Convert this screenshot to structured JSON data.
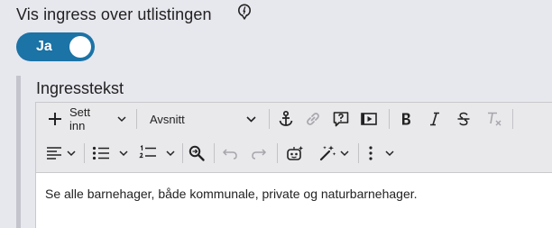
{
  "field": {
    "label": "Vis ingress over utlistingen",
    "help_icon": "info-pin-icon"
  },
  "toggle": {
    "label": "Ja",
    "on": true,
    "color": "#1b73a6"
  },
  "editor": {
    "label": "Ingresstekst",
    "toolbar": {
      "insert_label": "Sett inn",
      "block_format": "Avsnitt"
    },
    "content": "Se alle barnehager, både kommunale, private og naturbarnehager."
  }
}
